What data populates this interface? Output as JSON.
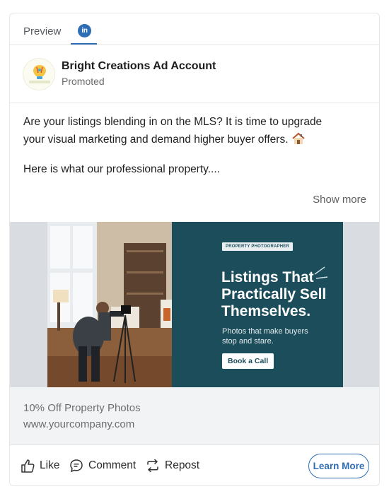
{
  "tabs": {
    "preview_label": "Preview",
    "linkedin_icon": "in"
  },
  "post": {
    "account_name": "Bright Creations Ad Account",
    "sponsored_label": "Promoted",
    "avatar_text": "bright creations",
    "body_line_1": "Are your listings blending in on the MLS? It is time to upgrade",
    "body_line_2": "your visual marketing and demand higher buyer offers.",
    "body_line_3": "Here is what our professional property....",
    "show_more": "Show more"
  },
  "ad_image": {
    "tag": "PROPERTY PHOTOGRAPHER",
    "headline_1": "Listings That",
    "headline_2": "Practically Sell",
    "headline_3": "Themselves.",
    "subline_1": "Photos that make buyers",
    "subline_2": "stop and stare.",
    "cta": "Book a Call"
  },
  "caption": {
    "title": "10% Off Property Photos",
    "url": "www.yourcompany.com"
  },
  "actions": {
    "like": "Like",
    "comment": "Comment",
    "repost": "Repost",
    "learn_more": "Learn More"
  },
  "colors": {
    "linkedin_blue": "#2f6db5",
    "ad_panel": "#1c4d5b",
    "caption_bg": "#f1f3f5"
  },
  "icons": [
    "linkedin-icon",
    "house-emoji-icon",
    "like-icon",
    "comment-icon",
    "repost-icon"
  ]
}
